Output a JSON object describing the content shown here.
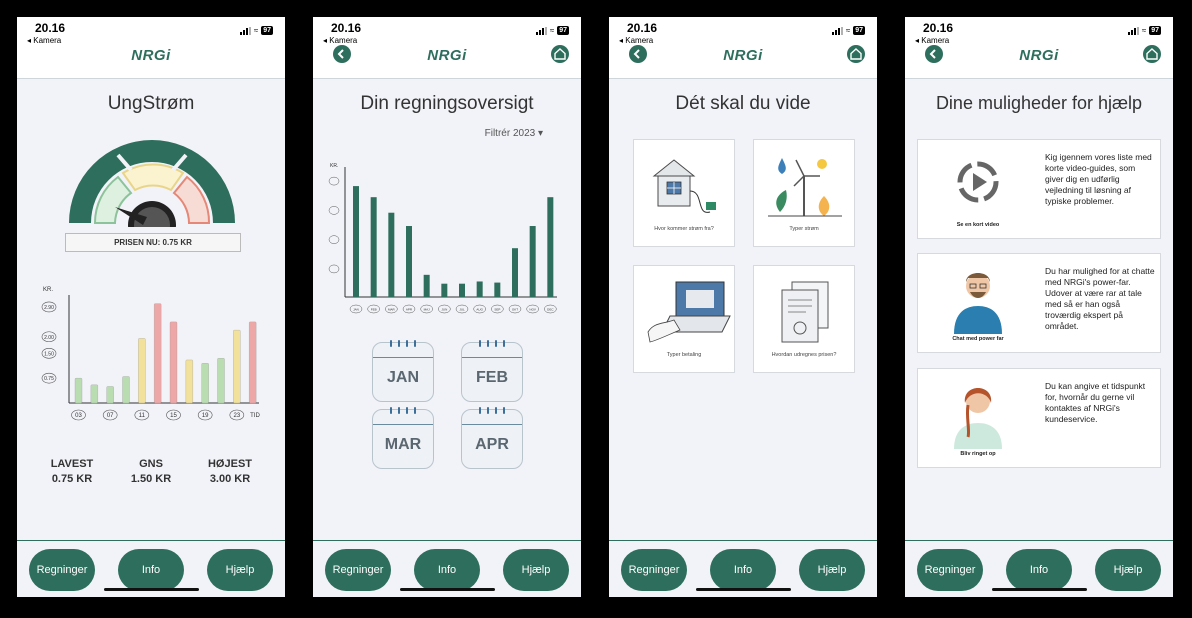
{
  "status": {
    "time": "20.16",
    "back_app": "◂ Kamera",
    "battery": "97"
  },
  "brand": "NRGi",
  "tabs": [
    "Regninger",
    "Info",
    "Hjælp"
  ],
  "screen1": {
    "title": "UngStrøm",
    "price_now": "PRISEN NU: 0.75 KR",
    "y_unit": "KR.",
    "y_ticks": [
      "2.90",
      "2.00",
      "1.50",
      "0.75"
    ],
    "x_ticks": [
      "03",
      "07",
      "11",
      "15",
      "19",
      "23"
    ],
    "x_unit": "TID",
    "stats": [
      {
        "label": "LAVEST",
        "value": "0.75 KR"
      },
      {
        "label": "GNS",
        "value": "1.50 KR"
      },
      {
        "label": "HØJEST",
        "value": "3.00 KR"
      }
    ],
    "chart_data": {
      "type": "bar",
      "values": [
        0.75,
        0.55,
        0.5,
        0.8,
        1.95,
        3.0,
        2.45,
        1.3,
        1.2,
        1.35,
        2.2,
        2.45
      ],
      "colors": [
        "#b9dcb1",
        "#b9dcb1",
        "#b9dcb1",
        "#b9dcb1",
        "#f1e19a",
        "#eea7a7",
        "#eea7a7",
        "#f1e19a",
        "#b9dcb1",
        "#b9dcb1",
        "#f1e19a",
        "#eea7a7"
      ],
      "ylim": [
        0,
        3.2
      ]
    }
  },
  "screen2": {
    "title": "Din regningsoversigt",
    "filter": "Filtrér 2023 ▾",
    "y_unit": "KR.",
    "months": [
      "JAN",
      "FEB",
      "MAR",
      "APR",
      "MAJ",
      "JUN",
      "JUL",
      "AUG",
      "SEP",
      "OKT",
      "NOV",
      "DEC"
    ],
    "chart_data": {
      "type": "bar",
      "values": [
        100,
        90,
        76,
        64,
        20,
        12,
        12,
        14,
        13,
        44,
        64,
        90
      ],
      "ylim": [
        0,
        110
      ],
      "colors": [
        "#2e6e5c"
      ]
    },
    "calendar_months": [
      "JAN",
      "FEB",
      "MAR",
      "APR"
    ]
  },
  "screen3": {
    "title": "Dét skal du vide",
    "cards": [
      "Hvor kommer strøm fra?",
      "Typer strøm",
      "Typer betaling",
      "Hvordan udregnes prisen?"
    ]
  },
  "screen4": {
    "title": "Dine muligheder for hjælp",
    "cards": [
      {
        "caption": "Se en kort video",
        "text": "Kig igennem vores liste med korte video-guides, som giver dig en udførlig vejledning til løsning af typiske problemer."
      },
      {
        "caption": "Chat med power far",
        "text": "Du har mulighed for at chatte med NRGi's power-far. Udover at være rar at tale med så er han også troværdig ekspert på området."
      },
      {
        "caption": "Bliv ringet op",
        "text": "Du kan angive et tidspunkt for, hvornår du gerne vil kontaktes af NRGi's kundeservice."
      }
    ]
  },
  "colors": {
    "primary": "#2e6e5c",
    "background": "#f2f3f8"
  }
}
